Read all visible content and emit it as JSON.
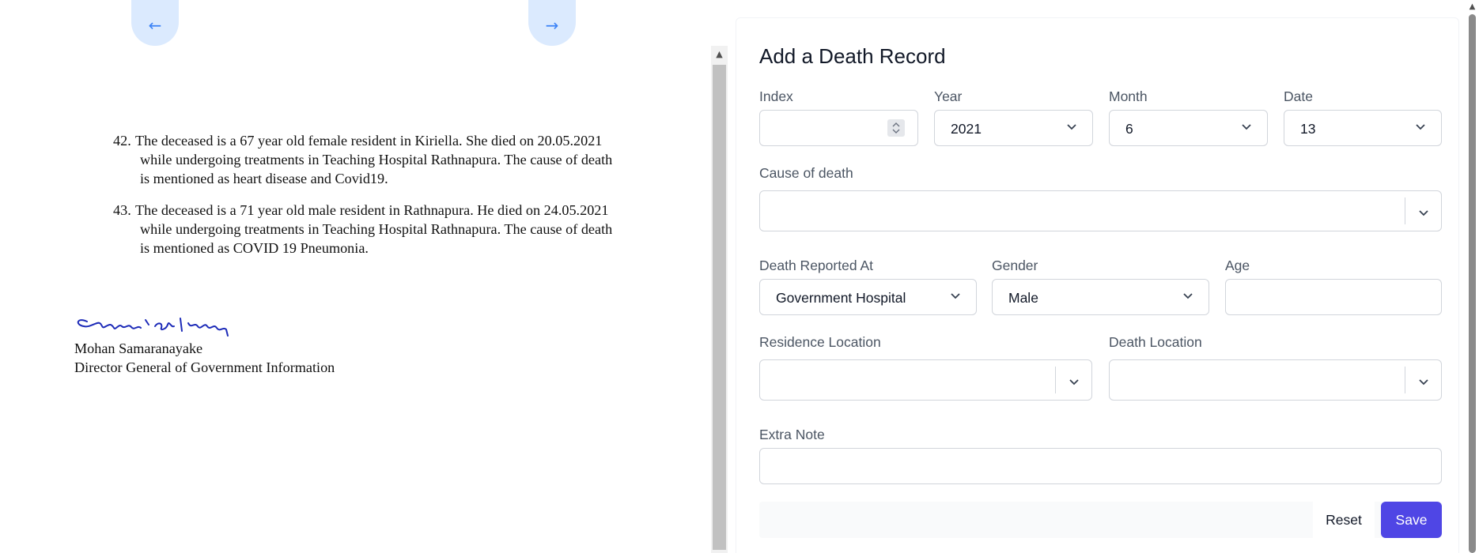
{
  "viewer": {
    "prev_glyph": "←",
    "next_glyph": "→",
    "items": [
      {
        "number": "42.",
        "lines": [
          "The deceased is a 67 year old female resident in Kiriella. She died on 20.05.2021",
          "while undergoing treatments in Teaching Hospital Rathnapura. The cause of death",
          "is mentioned as heart disease and Covid19."
        ]
      },
      {
        "number": "43.",
        "lines": [
          "The deceased is a 71 year old male resident in Rathnapura. He died on 24.05.2021",
          "while undergoing treatments in Teaching Hospital Rathnapura. The cause of death",
          "is mentioned as COVID 19 Pneumonia."
        ]
      }
    ],
    "signer_name": "Mohan Samaranayake",
    "signer_title": "Director General of Government Information"
  },
  "form": {
    "title": "Add a Death Record",
    "labels": {
      "index": "Index",
      "year": "Year",
      "month": "Month",
      "date": "Date",
      "cause": "Cause of death",
      "reported_at": "Death Reported At",
      "gender": "Gender",
      "age": "Age",
      "residence": "Residence Location",
      "death_location": "Death Location",
      "extra_note": "Extra Note"
    },
    "values": {
      "index": "",
      "year": "2021",
      "month": "6",
      "date": "13",
      "cause": "",
      "reported_at": "Government Hospital",
      "gender": "Male",
      "age": "",
      "residence": "",
      "death_location": "",
      "extra_note": ""
    },
    "buttons": {
      "reset": "Reset",
      "save": "Save"
    }
  },
  "colors": {
    "primary": "#4f46e5",
    "nav_button_bg": "#dbeafe",
    "nav_button_fg": "#3b82f6",
    "signature_ink": "#1d2bb8"
  },
  "icons": {
    "select_arrow": "chevron-down-icon",
    "number_spinner": "spinner-arrows-icon",
    "signature": "signature-icon"
  }
}
